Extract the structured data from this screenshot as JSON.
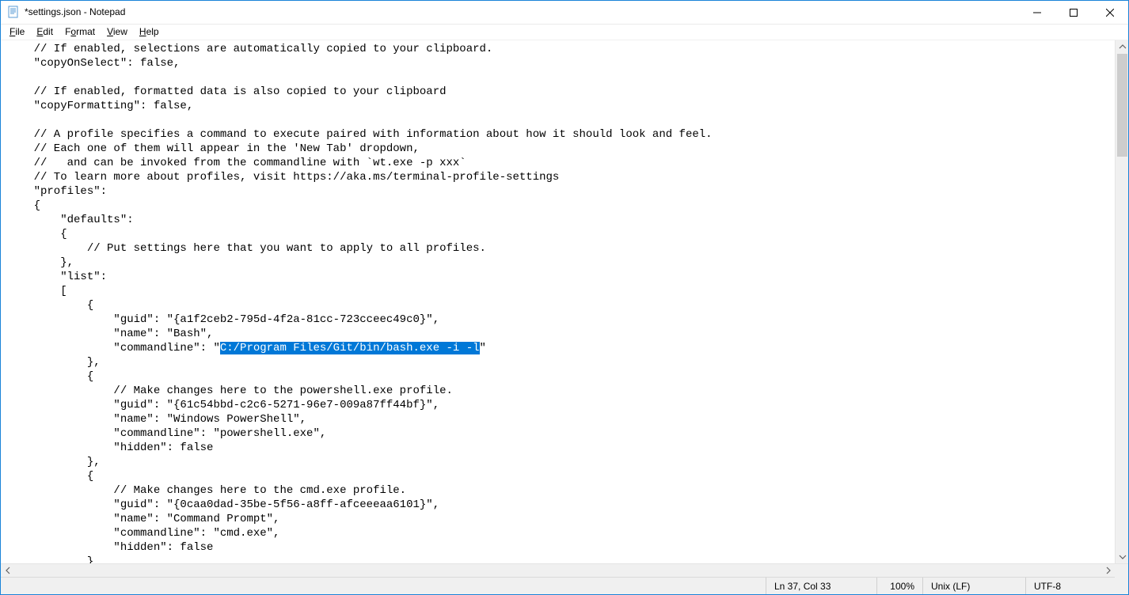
{
  "window": {
    "title": "*settings.json - Notepad"
  },
  "menu": {
    "file": "File",
    "edit": "Edit",
    "format": "Format",
    "view": "View",
    "help": "Help"
  },
  "editor": {
    "lines": [
      "    // If enabled, selections are automatically copied to your clipboard.",
      "    \"copyOnSelect\": false,",
      "",
      "    // If enabled, formatted data is also copied to your clipboard",
      "    \"copyFormatting\": false,",
      "",
      "    // A profile specifies a command to execute paired with information about how it should look and feel.",
      "    // Each one of them will appear in the 'New Tab' dropdown,",
      "    //   and can be invoked from the commandline with `wt.exe -p xxx`",
      "    // To learn more about profiles, visit https://aka.ms/terminal-profile-settings",
      "    \"profiles\":",
      "    {",
      "        \"defaults\":",
      "        {",
      "            // Put settings here that you want to apply to all profiles.",
      "        },",
      "        \"list\":",
      "        [",
      "            {",
      "                \"guid\": \"{a1f2ceb2-795d-4f2a-81cc-723cceec49c0}\",",
      "                \"name\": \"Bash\",",
      "",
      "            },",
      "            {",
      "                // Make changes here to the powershell.exe profile.",
      "                \"guid\": \"{61c54bbd-c2c6-5271-96e7-009a87ff44bf}\",",
      "                \"name\": \"Windows PowerShell\",",
      "                \"commandline\": \"powershell.exe\",",
      "                \"hidden\": false",
      "            },",
      "            {",
      "                // Make changes here to the cmd.exe profile.",
      "                \"guid\": \"{0caa0dad-35be-5f56-a8ff-afceeeaa6101}\",",
      "                \"name\": \"Command Prompt\",",
      "                \"commandline\": \"cmd.exe\",",
      "                \"hidden\": false",
      "            }"
    ],
    "commandline_prefix": "                \"commandline\": \"",
    "commandline_selected": "C:/Program Files/Git/bin/bash.exe -i -l",
    "commandline_suffix": "\""
  },
  "status": {
    "lncol": "Ln 37, Col 33",
    "zoom": "100%",
    "eol": "Unix (LF)",
    "encoding": "UTF-8"
  }
}
